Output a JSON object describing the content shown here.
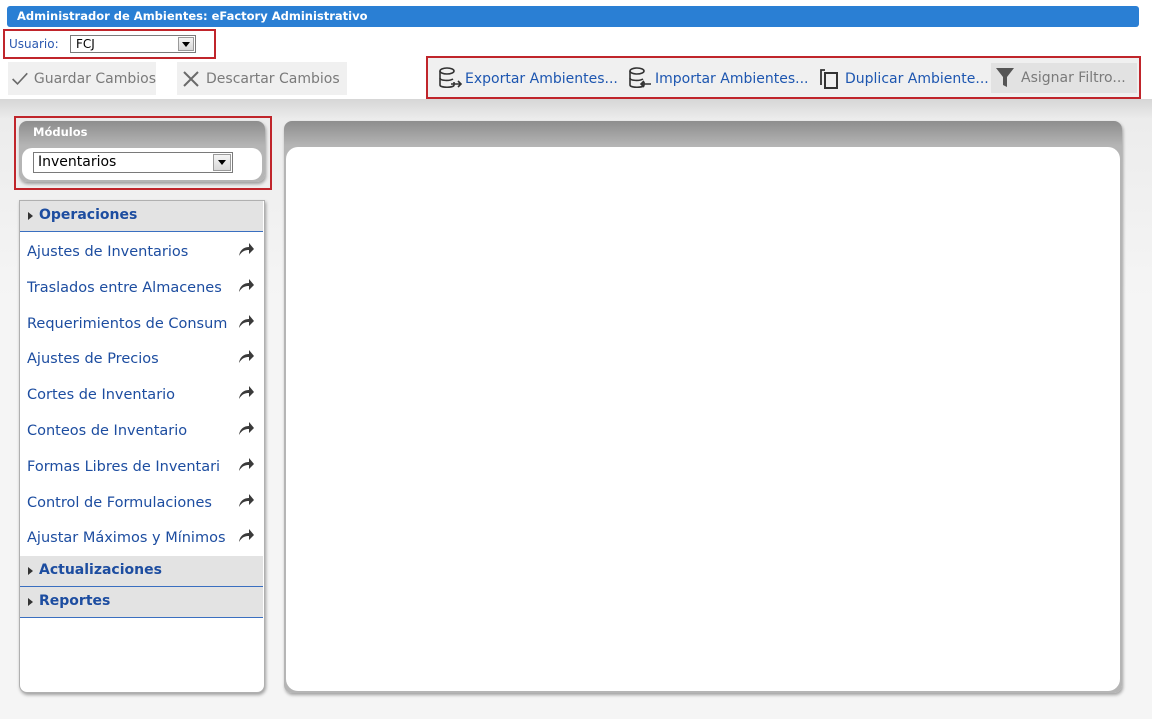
{
  "window": {
    "title": "Administrador de Ambientes: eFactory Administrativo"
  },
  "user": {
    "label": "Usuario:",
    "value": "FCJ"
  },
  "toolbar": {
    "save_label": "Guardar Cambios",
    "discard_label": "Descartar Cambios"
  },
  "actions": {
    "export_label": "Exportar Ambientes...",
    "import_label": "Importar Ambientes...",
    "duplicate_label": "Duplicar Ambiente...",
    "filter_label": "Asignar Filtro..."
  },
  "modules": {
    "title": "Módulos",
    "selected": "Inventarios"
  },
  "menu": {
    "sections": [
      {
        "label": "Operaciones"
      },
      {
        "label": "Actualizaciones"
      },
      {
        "label": "Reportes"
      }
    ],
    "items": [
      {
        "label": "Ajustes de Inventarios"
      },
      {
        "label": "Traslados entre Almacenes"
      },
      {
        "label": "Requerimientos de Consum"
      },
      {
        "label": "Ajustes de Precios"
      },
      {
        "label": "Cortes de Inventario"
      },
      {
        "label": "Conteos de Inventario"
      },
      {
        "label": "Formas Libres de Inventari"
      },
      {
        "label": "Control de Formulaciones"
      },
      {
        "label": "Ajustar Máximos y Mínimos"
      }
    ]
  },
  "colors": {
    "titlebar": "#2a7fd4",
    "highlight_border": "#c0252b",
    "link": "#1d4da0"
  }
}
